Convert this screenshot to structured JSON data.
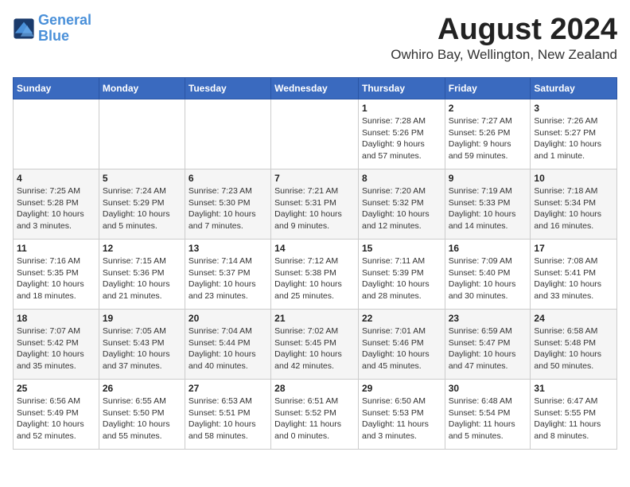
{
  "logo": {
    "line1": "General",
    "line2": "Blue"
  },
  "title": "August 2024",
  "location": "Owhiro Bay, Wellington, New Zealand",
  "weekdays": [
    "Sunday",
    "Monday",
    "Tuesday",
    "Wednesday",
    "Thursday",
    "Friday",
    "Saturday"
  ],
  "weeks": [
    [
      {
        "day": "",
        "info": ""
      },
      {
        "day": "",
        "info": ""
      },
      {
        "day": "",
        "info": ""
      },
      {
        "day": "",
        "info": ""
      },
      {
        "day": "1",
        "info": "Sunrise: 7:28 AM\nSunset: 5:26 PM\nDaylight: 9 hours\nand 57 minutes."
      },
      {
        "day": "2",
        "info": "Sunrise: 7:27 AM\nSunset: 5:26 PM\nDaylight: 9 hours\nand 59 minutes."
      },
      {
        "day": "3",
        "info": "Sunrise: 7:26 AM\nSunset: 5:27 PM\nDaylight: 10 hours\nand 1 minute."
      }
    ],
    [
      {
        "day": "4",
        "info": "Sunrise: 7:25 AM\nSunset: 5:28 PM\nDaylight: 10 hours\nand 3 minutes."
      },
      {
        "day": "5",
        "info": "Sunrise: 7:24 AM\nSunset: 5:29 PM\nDaylight: 10 hours\nand 5 minutes."
      },
      {
        "day": "6",
        "info": "Sunrise: 7:23 AM\nSunset: 5:30 PM\nDaylight: 10 hours\nand 7 minutes."
      },
      {
        "day": "7",
        "info": "Sunrise: 7:21 AM\nSunset: 5:31 PM\nDaylight: 10 hours\nand 9 minutes."
      },
      {
        "day": "8",
        "info": "Sunrise: 7:20 AM\nSunset: 5:32 PM\nDaylight: 10 hours\nand 12 minutes."
      },
      {
        "day": "9",
        "info": "Sunrise: 7:19 AM\nSunset: 5:33 PM\nDaylight: 10 hours\nand 14 minutes."
      },
      {
        "day": "10",
        "info": "Sunrise: 7:18 AM\nSunset: 5:34 PM\nDaylight: 10 hours\nand 16 minutes."
      }
    ],
    [
      {
        "day": "11",
        "info": "Sunrise: 7:16 AM\nSunset: 5:35 PM\nDaylight: 10 hours\nand 18 minutes."
      },
      {
        "day": "12",
        "info": "Sunrise: 7:15 AM\nSunset: 5:36 PM\nDaylight: 10 hours\nand 21 minutes."
      },
      {
        "day": "13",
        "info": "Sunrise: 7:14 AM\nSunset: 5:37 PM\nDaylight: 10 hours\nand 23 minutes."
      },
      {
        "day": "14",
        "info": "Sunrise: 7:12 AM\nSunset: 5:38 PM\nDaylight: 10 hours\nand 25 minutes."
      },
      {
        "day": "15",
        "info": "Sunrise: 7:11 AM\nSunset: 5:39 PM\nDaylight: 10 hours\nand 28 minutes."
      },
      {
        "day": "16",
        "info": "Sunrise: 7:09 AM\nSunset: 5:40 PM\nDaylight: 10 hours\nand 30 minutes."
      },
      {
        "day": "17",
        "info": "Sunrise: 7:08 AM\nSunset: 5:41 PM\nDaylight: 10 hours\nand 33 minutes."
      }
    ],
    [
      {
        "day": "18",
        "info": "Sunrise: 7:07 AM\nSunset: 5:42 PM\nDaylight: 10 hours\nand 35 minutes."
      },
      {
        "day": "19",
        "info": "Sunrise: 7:05 AM\nSunset: 5:43 PM\nDaylight: 10 hours\nand 37 minutes."
      },
      {
        "day": "20",
        "info": "Sunrise: 7:04 AM\nSunset: 5:44 PM\nDaylight: 10 hours\nand 40 minutes."
      },
      {
        "day": "21",
        "info": "Sunrise: 7:02 AM\nSunset: 5:45 PM\nDaylight: 10 hours\nand 42 minutes."
      },
      {
        "day": "22",
        "info": "Sunrise: 7:01 AM\nSunset: 5:46 PM\nDaylight: 10 hours\nand 45 minutes."
      },
      {
        "day": "23",
        "info": "Sunrise: 6:59 AM\nSunset: 5:47 PM\nDaylight: 10 hours\nand 47 minutes."
      },
      {
        "day": "24",
        "info": "Sunrise: 6:58 AM\nSunset: 5:48 PM\nDaylight: 10 hours\nand 50 minutes."
      }
    ],
    [
      {
        "day": "25",
        "info": "Sunrise: 6:56 AM\nSunset: 5:49 PM\nDaylight: 10 hours\nand 52 minutes."
      },
      {
        "day": "26",
        "info": "Sunrise: 6:55 AM\nSunset: 5:50 PM\nDaylight: 10 hours\nand 55 minutes."
      },
      {
        "day": "27",
        "info": "Sunrise: 6:53 AM\nSunset: 5:51 PM\nDaylight: 10 hours\nand 58 minutes."
      },
      {
        "day": "28",
        "info": "Sunrise: 6:51 AM\nSunset: 5:52 PM\nDaylight: 11 hours\nand 0 minutes."
      },
      {
        "day": "29",
        "info": "Sunrise: 6:50 AM\nSunset: 5:53 PM\nDaylight: 11 hours\nand 3 minutes."
      },
      {
        "day": "30",
        "info": "Sunrise: 6:48 AM\nSunset: 5:54 PM\nDaylight: 11 hours\nand 5 minutes."
      },
      {
        "day": "31",
        "info": "Sunrise: 6:47 AM\nSunset: 5:55 PM\nDaylight: 11 hours\nand 8 minutes."
      }
    ]
  ]
}
